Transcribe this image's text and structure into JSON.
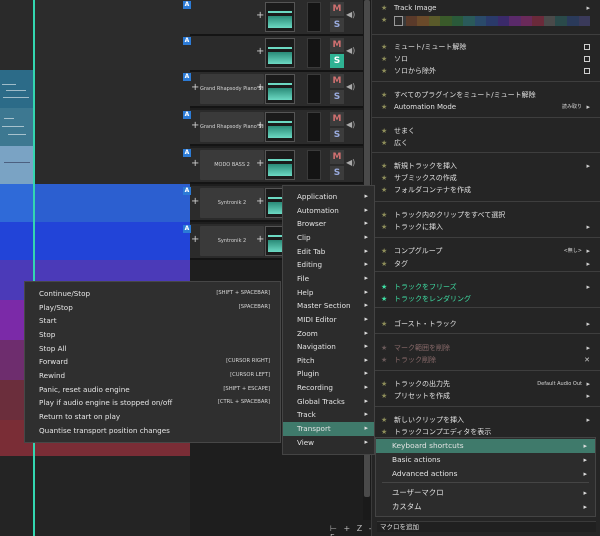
{
  "tracks": [
    {
      "name": "",
      "mute": "M",
      "solo": "S",
      "solo_on": false
    },
    {
      "name": "",
      "mute": "M",
      "solo": "S",
      "solo_on": true
    },
    {
      "name": "Grand Rhapsody Piano Stereo",
      "mute": "M",
      "solo": "S",
      "solo_on": false
    },
    {
      "name": "Grand Rhapsody Piano Stereo",
      "mute": "M",
      "solo": "S",
      "solo_on": false
    },
    {
      "name": "MODO BASS 2",
      "mute": "M",
      "solo": "S",
      "solo_on": false
    },
    {
      "name": "Syntronik 2",
      "mute": "",
      "solo": "",
      "solo_on": false
    },
    {
      "name": "Syntronik 2",
      "mute": "",
      "solo": "",
      "solo_on": false
    }
  ],
  "badge_label": "A",
  "transport_panel": {
    "items": [
      {
        "label": "Continue/Stop",
        "shortcut": "[SHIFT + SPACEBAR]"
      },
      {
        "label": "Play/Stop",
        "shortcut": "[SPACEBAR]"
      },
      {
        "label": "Start",
        "shortcut": ""
      },
      {
        "label": "Stop",
        "shortcut": ""
      },
      {
        "label": "Stop All",
        "shortcut": ""
      },
      {
        "label": "Forward",
        "shortcut": "[CURSOR RIGHT]"
      },
      {
        "label": "Rewind",
        "shortcut": "[CURSOR LEFT]"
      },
      {
        "label": "Panic, reset audio engine",
        "shortcut": "[SHIFT + ESCAPE]"
      },
      {
        "label": "Play if audio engine is stopped on/off",
        "shortcut": "[CTRL + SPACEBAR]"
      },
      {
        "label": "Return to start on play",
        "shortcut": ""
      },
      {
        "label": "Quantise transport position changes",
        "shortcut": ""
      }
    ]
  },
  "shortcut_menu": {
    "items": [
      {
        "label": "Application"
      },
      {
        "label": "Automation"
      },
      {
        "label": "Browser"
      },
      {
        "label": "Clip"
      },
      {
        "label": "Edit Tab"
      },
      {
        "label": "Editing"
      },
      {
        "label": "File"
      },
      {
        "label": "Help"
      },
      {
        "label": "Master Section"
      },
      {
        "label": "MIDI Editor"
      },
      {
        "label": "Zoom"
      },
      {
        "label": "Navigation"
      },
      {
        "label": "Pitch"
      },
      {
        "label": "Plugin"
      },
      {
        "label": "Recording"
      },
      {
        "label": "Global Tracks"
      },
      {
        "label": "Track"
      },
      {
        "label": "Transport"
      },
      {
        "label": "View"
      }
    ],
    "active_index": 17
  },
  "macro_menu": {
    "items": [
      {
        "label": "Keyboard shortcuts"
      },
      {
        "label": "Basic actions"
      },
      {
        "label": "Advanced actions"
      },
      {
        "label": "ユーザーマクロ"
      },
      {
        "label": "カスタム"
      }
    ],
    "active_index": 0
  },
  "context_menu": {
    "track_image_label": "Track Image",
    "rows": [
      {
        "label": "ミュート/ミュート解除",
        "type": "check"
      },
      {
        "label": "ソロ",
        "type": "check"
      },
      {
        "label": "ソロから除外",
        "type": "check"
      },
      {
        "label": "すべてのプラグインをミュート/ミュート解除",
        "type": "plain"
      },
      {
        "label": "Automation Mode",
        "type": "kbd",
        "kbd": "読み取り"
      },
      {
        "label": "せまく",
        "type": "plain"
      },
      {
        "label": "広く",
        "type": "plain"
      },
      {
        "label": "新規トラックを挿入",
        "type": "chev"
      },
      {
        "label": "サブミックスの作成",
        "type": "plain"
      },
      {
        "label": "フォルダコンテナを作成",
        "type": "plain"
      },
      {
        "label": "トラック内のクリップをすべて選択",
        "type": "plain"
      },
      {
        "label": "トラックに挿入",
        "type": "chev"
      },
      {
        "label": "コンプグループ",
        "type": "kbd",
        "kbd": "<無し>"
      },
      {
        "label": "タグ",
        "type": "chev"
      },
      {
        "label": "トラックをフリーズ",
        "type": "green-chev"
      },
      {
        "label": "トラックをレンダリング",
        "type": "green"
      },
      {
        "label": "ゴースト・トラック",
        "type": "chev"
      },
      {
        "label": "マーク範囲を削除",
        "type": "dim-chev"
      },
      {
        "label": "トラック削除",
        "type": "dim-x"
      },
      {
        "label": "トラックの出力先",
        "type": "kbd",
        "kbd": "Default Audio Out"
      },
      {
        "label": "プリセットを作成",
        "type": "chev"
      },
      {
        "label": "新しいクリップを挿入",
        "type": "chev"
      },
      {
        "label": "トラックコンプエディタを表示",
        "type": "plain"
      }
    ],
    "add_macro_label": "マクロを追加"
  },
  "zoom_controls": "⊢ + Z - F",
  "colors": {
    "accent": "#3fe0a5",
    "active_item": "#3f7a6b",
    "playhead": "#33d6b0",
    "badge": "#2c7bd6"
  }
}
